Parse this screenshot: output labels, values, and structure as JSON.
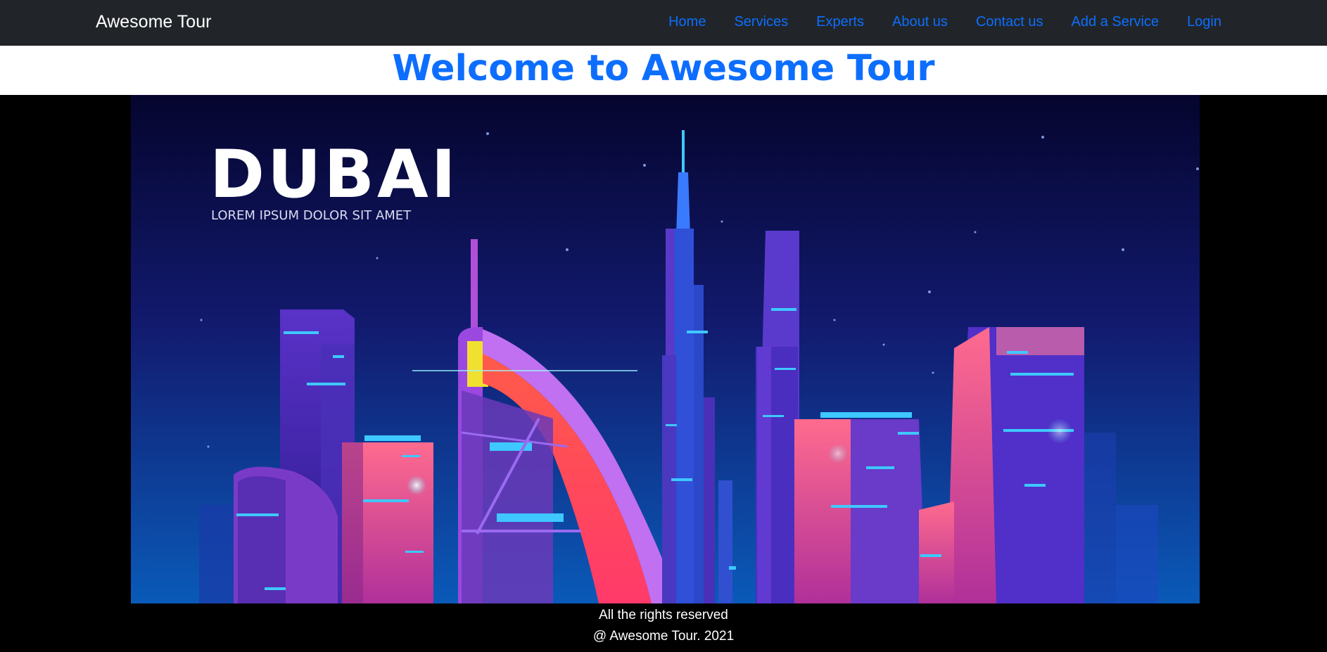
{
  "navbar": {
    "brand": "Awesome Tour",
    "links": [
      "Home",
      "Services",
      "Experts",
      "About us",
      "Contact us",
      "Add a Service",
      "Login"
    ]
  },
  "hero": {
    "heading": "Welcome to Awesome Tour"
  },
  "banner": {
    "title": "DUBAI",
    "subtitle": "LOREM IPSUM DOLOR SIT AMET"
  },
  "footer": {
    "line1": "All the rights reserved",
    "line2": "@ Awesome Tour. 2021"
  },
  "colors": {
    "navbar_bg": "#212529",
    "link": "#0d6efd",
    "heading": "#0d6efd",
    "page_bg": "#000000"
  }
}
